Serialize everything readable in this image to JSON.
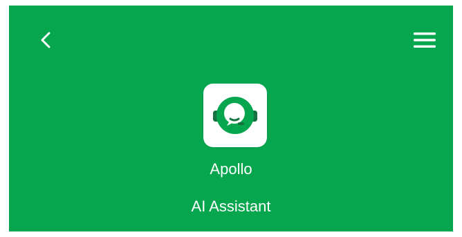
{
  "header": {
    "background_color": "#06a64e",
    "back_icon": "chevron-left-icon",
    "menu_icon": "hamburger-menu-icon"
  },
  "app": {
    "icon": "support-headset-chat-icon",
    "name": "Apollo",
    "subtitle": "AI Assistant"
  }
}
